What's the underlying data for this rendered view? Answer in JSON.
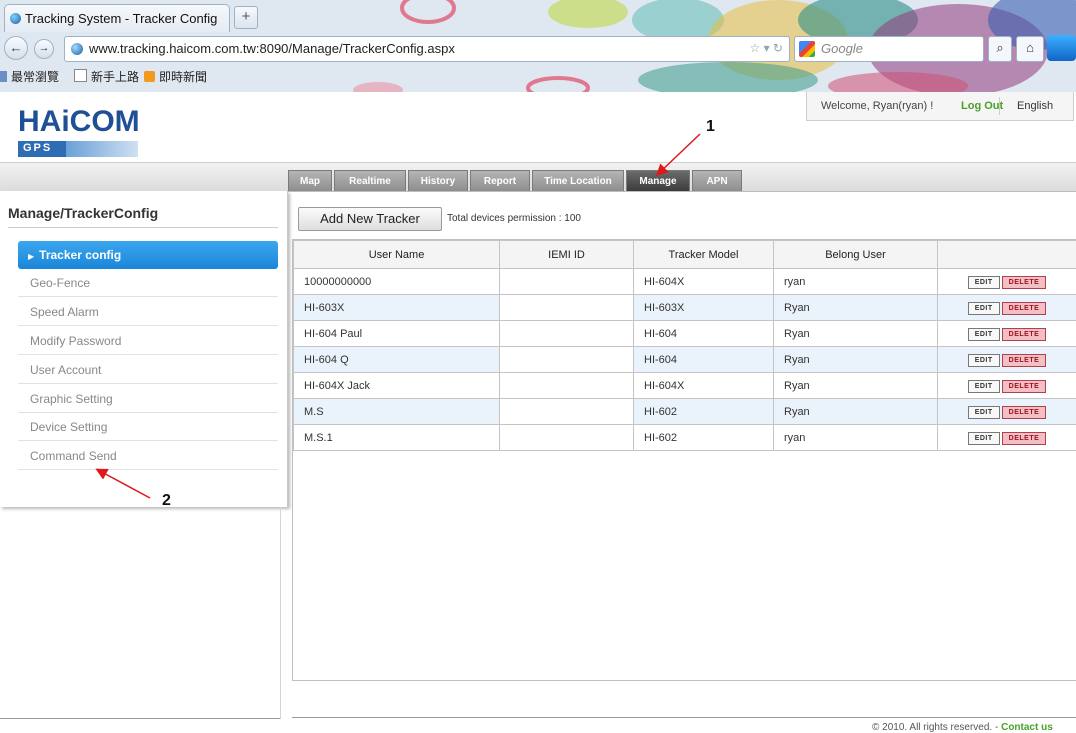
{
  "browser": {
    "tab_title": "Tracking System - Tracker Config",
    "new_tab": "+",
    "url": "www.tracking.haicom.com.tw:8090/Manage/TrackerConfig.aspx",
    "search_placeholder": "Google",
    "bookmarks": [
      "最常瀏覽",
      "新手上路",
      "即時新聞"
    ]
  },
  "header": {
    "logo": "HAiCOM",
    "logo_sub": "GPS",
    "welcome": "Welcome, Ryan(ryan) !",
    "logout": "Log Out",
    "language": "English"
  },
  "menu": {
    "tabs": [
      "Map",
      "Realtime",
      "History",
      "Report",
      "Time Location",
      "Manage",
      "APN"
    ],
    "active": "Manage"
  },
  "sidebar": {
    "title": "Manage/TrackerConfig",
    "items": [
      "Tracker config",
      "Geo-Fence",
      "Speed Alarm",
      "Modify Password",
      "User Account",
      "Graphic Setting",
      "Device Setting",
      "Command Send"
    ],
    "active_item": "Tracker config"
  },
  "main": {
    "add_button": "Add New Tracker",
    "permission": "Total devices permission : 100",
    "columns": [
      "User Name",
      "IEMI ID",
      "Tracker Model",
      "Belong User",
      ""
    ],
    "rows": [
      {
        "user": "10000000000",
        "imei": "",
        "model": "HI-604X",
        "belong": "ryan"
      },
      {
        "user": "HI-603X",
        "imei": "",
        "model": "HI-603X",
        "belong": "Ryan"
      },
      {
        "user": "HI-604 Paul",
        "imei": "",
        "model": "HI-604",
        "belong": "Ryan"
      },
      {
        "user": "HI-604 Q",
        "imei": "",
        "model": "HI-604",
        "belong": "Ryan"
      },
      {
        "user": "HI-604X Jack",
        "imei": "",
        "model": "HI-604X",
        "belong": "Ryan"
      },
      {
        "user": "M.S",
        "imei": "",
        "model": "HI-602",
        "belong": "Ryan"
      },
      {
        "user": "M.S.1",
        "imei": "",
        "model": "HI-602",
        "belong": "ryan"
      }
    ],
    "edit_label": "EDIT",
    "delete_label": "DELETE"
  },
  "footer": {
    "copyright": "© 2010. All rights reserved. - ",
    "contact": "Contact us"
  },
  "annotations": [
    "1",
    "2"
  ],
  "colors": {
    "accent_blue": "#1a86d8",
    "link_green": "#48a02a",
    "delete_red": "#a01020",
    "logo_blue": "#1f4f95"
  }
}
